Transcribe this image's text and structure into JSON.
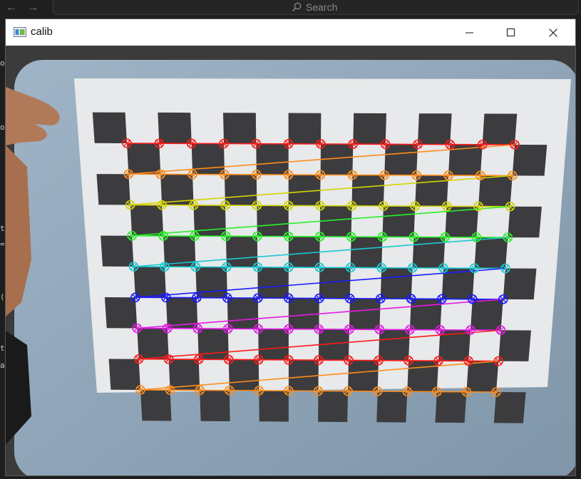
{
  "host": {
    "search_placeholder": "Search",
    "edge_chars": [
      "o",
      "op",
      "t",
      "=",
      "(",
      "t",
      "a"
    ]
  },
  "window": {
    "title": "calib"
  },
  "icons": {
    "back": "arrow-left-icon",
    "forward": "arrow-right-icon",
    "search": "search-icon",
    "app": "window-app-icon",
    "minimize": "minimize-icon",
    "maximize": "maximize-icon",
    "close": "close-icon"
  },
  "calibration": {
    "pattern_cols": 13,
    "pattern_rows": 9,
    "row_colors": [
      "#ff1a1a",
      "#ff8c1a",
      "#d4d400",
      "#29f029",
      "#19c8d2",
      "#1a1aff",
      "#e619e6",
      "#ff1a1a",
      "#ff8c1a"
    ]
  }
}
